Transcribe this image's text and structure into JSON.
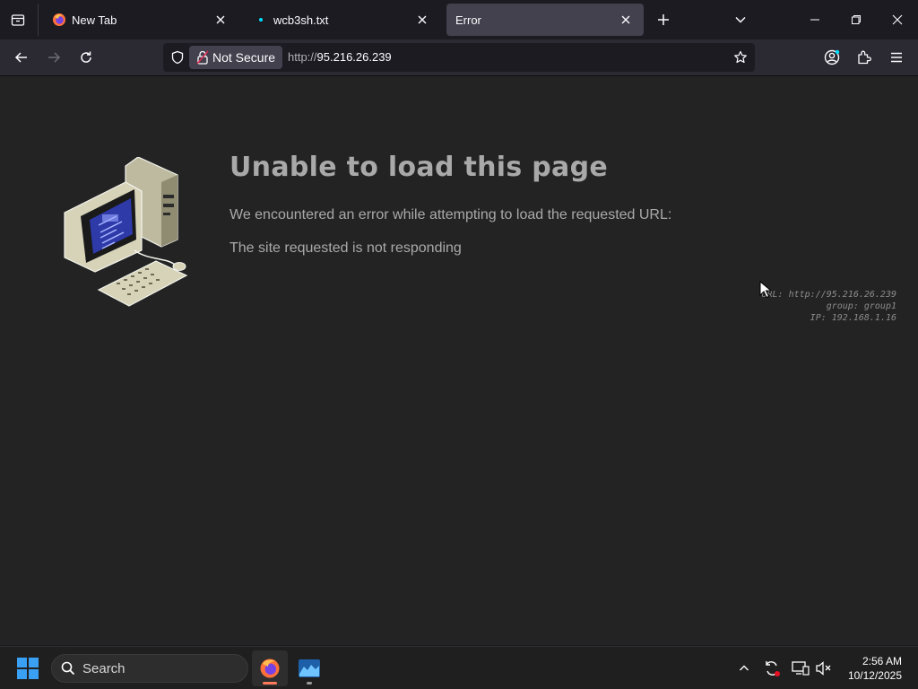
{
  "browser": {
    "tabs": [
      {
        "title": "New Tab",
        "icon": "firefox-icon"
      },
      {
        "title": "wcb3sh.txt",
        "icon": "file-dot-icon"
      },
      {
        "title": "Error",
        "icon": "",
        "active": true
      }
    ],
    "security_label": "Not Secure",
    "url_scheme": "http://",
    "url_host": "95.216.26.239"
  },
  "page": {
    "title": "Unable to load this page",
    "line1": "We encountered an error while attempting to load the requested URL:",
    "line2": "The site requested is not responding",
    "meta_url": "URL: http://95.216.26.239",
    "meta_group": "group: group1",
    "meta_ip": "IP: 192.168.1.16"
  },
  "taskbar": {
    "search_label": "Search",
    "time": "2:56 AM",
    "date": "10/12/2025"
  },
  "colors": {
    "accent_firefox": "#ff7139",
    "windows_blue": "#0078d4",
    "error_text": "#a9a9a9"
  }
}
